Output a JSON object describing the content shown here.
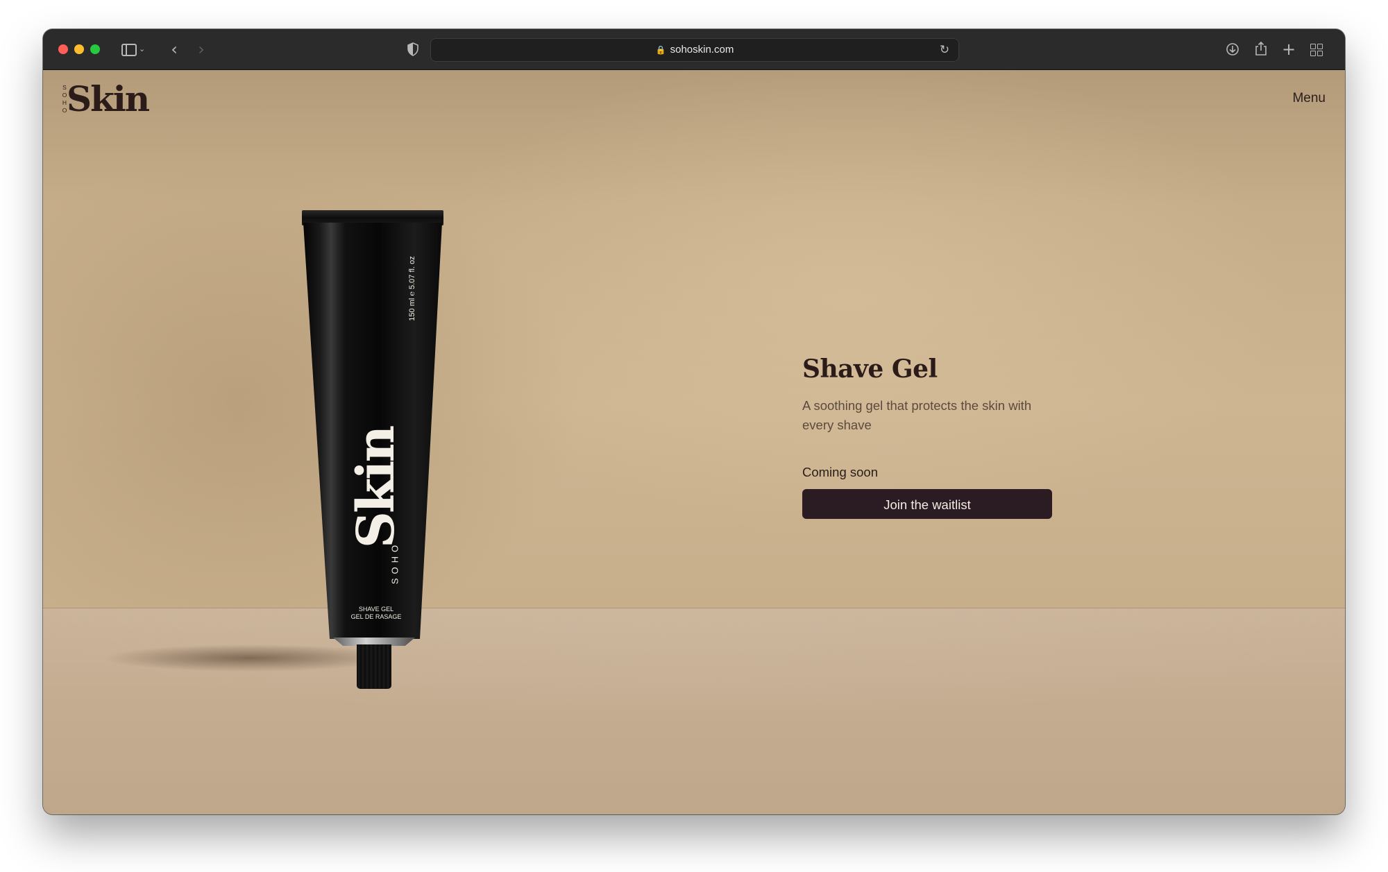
{
  "browser": {
    "url": "sohoskin.com",
    "icons": {
      "sidebar": "sidebar-toggle-icon",
      "back": "chevron-left-icon",
      "forward": "chevron-right-icon",
      "privacy": "shield-icon",
      "lock": "lock-icon",
      "reload": "reload-icon",
      "download": "download-icon",
      "share": "share-icon",
      "new_tab": "plus-icon",
      "tab_overview": "tab-grid-icon"
    }
  },
  "site": {
    "logo_small": "SOHO",
    "logo_main": "Skin",
    "menu_label": "Menu"
  },
  "product": {
    "title": "Shave Gel",
    "description": "A soothing gel that protects the skin with every shave",
    "status": "Coming soon",
    "cta_label": "Join the waitlist",
    "tube": {
      "brand": "Skin",
      "brand_small": "SOHO",
      "volume": "150 ml ℮ 5.07 fl. oz",
      "name_en": "SHAVE GEL",
      "name_fr": "GEL DE RASAGE"
    }
  },
  "colors": {
    "background_wall": "#c6ad89",
    "text_dark": "#2b1c1a",
    "button_bg": "#2b1c24",
    "button_text": "#f2ece4"
  }
}
